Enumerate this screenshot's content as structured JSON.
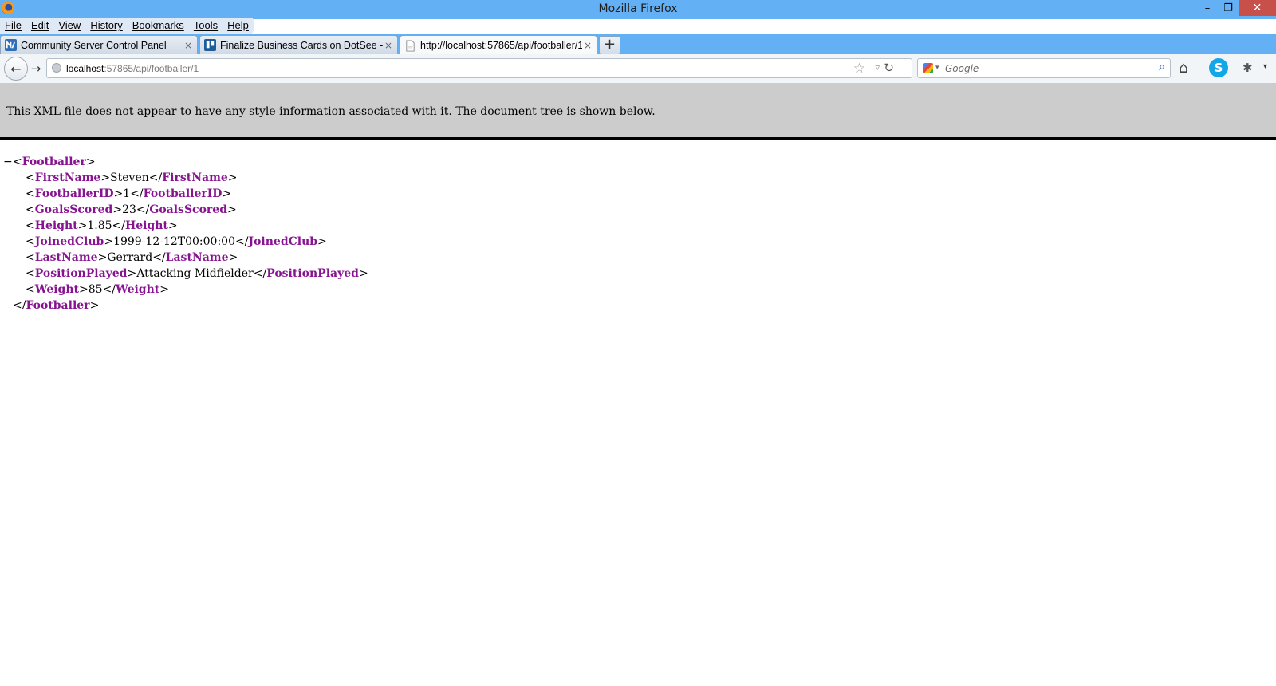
{
  "window": {
    "title": "Mozilla Firefox",
    "controls": {
      "minimize": "–",
      "restore": "❐",
      "close": "✕"
    }
  },
  "menu": [
    "File",
    "Edit",
    "View",
    "History",
    "Bookmarks",
    "Tools",
    "Help"
  ],
  "tabs": [
    {
      "label": "Community Server Control Panel",
      "icon": "community-server-icon",
      "close": "×"
    },
    {
      "label": "Finalize Business Cards on DotSee - N...",
      "icon": "trello-icon",
      "close": "×"
    },
    {
      "label": "http://localhost:57865/api/footballer/1",
      "icon": "blank-page-icon",
      "close": "×",
      "active": true
    }
  ],
  "new_tab": "+",
  "nav": {
    "back": "←",
    "forward": "→",
    "url_host": "localhost",
    "url_rest": ":57865/api/footballer/1",
    "star": "☆",
    "dropdown": "▿",
    "reload": "↻",
    "search_placeholder": "Google",
    "search_go": "⌕",
    "home": "⌂",
    "skype": "S",
    "extension": "✱",
    "menu": "▾"
  },
  "xml_info": "This XML file does not appear to have any style information associated with it. The document tree is shown below.",
  "xml": {
    "collapse": "−",
    "root": "Footballer",
    "children": [
      {
        "tag": "FirstName",
        "value": "Steven"
      },
      {
        "tag": "FootballerID",
        "value": "1"
      },
      {
        "tag": "GoalsScored",
        "value": "23"
      },
      {
        "tag": "Height",
        "value": "1.85"
      },
      {
        "tag": "JoinedClub",
        "value": "1999-12-12T00:00:00"
      },
      {
        "tag": "LastName",
        "value": "Gerrard"
      },
      {
        "tag": "PositionPlayed",
        "value": "Attacking Midfielder"
      },
      {
        "tag": "Weight",
        "value": "85"
      }
    ]
  },
  "colors": {
    "titlebar": "#63b0f5",
    "close_button": "#c7504a",
    "xml_tag": "#881391",
    "info_banner": "#cccccc"
  }
}
